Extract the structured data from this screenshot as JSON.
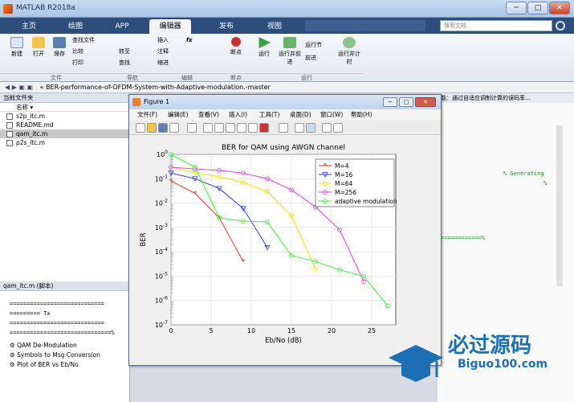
{
  "window": {
    "title": "MATLAB R2018a",
    "minimize": "─",
    "maximize": "□",
    "close": "✕"
  },
  "tabs": [
    "主页",
    "绘图",
    "APP",
    "编辑器",
    "发布",
    "视图"
  ],
  "search": {
    "placeholder": "搜索文档"
  },
  "ribbon": {
    "new": "新建",
    "open": "打开",
    "save": "保存",
    "find_files": "查找文件",
    "compare": "比较",
    "print": "打印",
    "goto": "转至",
    "find": "查找",
    "insert": "插入",
    "comment": "注释",
    "indent": "缩进",
    "fx": "fx",
    "breakpoints": "断点",
    "run": "运行",
    "run_advance": "运行并前进",
    "run_section": "运行节",
    "advance": "前进",
    "run_time": "运行并计时",
    "groups": {
      "file": "文件",
      "navigate": "导航",
      "edit": "编辑",
      "breakpoints": "断点",
      "run": "运行"
    }
  },
  "path": {
    "text": "«  BER-performance-of-OFDM-System-with-Adaptive-modulation.-master"
  },
  "current_folder": {
    "header": "当前文件夹",
    "name_col": "名称 ▾",
    "files": [
      "s2p_itc.m",
      "README.md",
      "qam_itc.m",
      "p2s_itc.m"
    ],
    "selected": 2
  },
  "details": {
    "header": "qam_itc.m  (脚本)",
    "lines": [
      "============================",
      "========= Tx",
      "============================",
      "==============================%"
    ],
    "items": [
      "QAM De-Modulation",
      "Symbols to Msg Conversion",
      "Plot of  BER vs Eb/No"
    ]
  },
  "editor_right": {
    "header": "能：通过自适应调制计算的误码率...",
    "line1": "% Generating",
    "line2": "%",
    "line3": "=============%"
  },
  "figure": {
    "title": "Figure 1",
    "menu": [
      "文件(F)",
      "编辑(E)",
      "查看(V)",
      "插入(I)",
      "工具(T)",
      "桌面(D)",
      "窗口(W)",
      "帮助(H)"
    ]
  },
  "watermark": {
    "cn": "必过源码",
    "en": "Biguo100.com"
  },
  "chart_data": {
    "type": "line",
    "title": "BER for QAM using AWGN channel",
    "xlabel": "Eb/No (dB)",
    "ylabel": "BER",
    "xlim": [
      0,
      28
    ],
    "ylim": [
      1e-07,
      1
    ],
    "yscale": "log",
    "grid": true,
    "legend_position": "top-right",
    "xticks": [
      0,
      5,
      10,
      15,
      20,
      25
    ],
    "yticks": [
      "10^0",
      "10^-1",
      "10^-2",
      "10^-3",
      "10^-4",
      "10^-5",
      "10^-6",
      "10^-7"
    ],
    "series": [
      {
        "name": "M=4",
        "color": "#e8322b",
        "marker": "*",
        "x": [
          0,
          3,
          6,
          9
        ],
        "y": [
          0.08,
          0.025,
          0.0025,
          4e-05
        ]
      },
      {
        "name": "M=16",
        "color": "#2b3fd6",
        "marker": "v",
        "x": [
          0,
          3,
          6,
          9,
          12
        ],
        "y": [
          0.17,
          0.1,
          0.04,
          0.006,
          0.00015
        ]
      },
      {
        "name": "M=64",
        "color": "#f2e600",
        "marker": "o",
        "x": [
          0,
          3,
          6,
          9,
          12,
          15,
          18
        ],
        "y": [
          0.3,
          0.18,
          0.12,
          0.07,
          0.03,
          0.003,
          2e-05
        ]
      },
      {
        "name": "M=256",
        "color": "#e53ef2",
        "marker": "o",
        "x": [
          0,
          3,
          6,
          9,
          12,
          15,
          18,
          21,
          24
        ],
        "y": [
          0.3,
          0.25,
          0.22,
          0.17,
          0.1,
          0.035,
          0.007,
          0.0008,
          6e-06
        ]
      },
      {
        "name": "adaptive modulation",
        "color": "#3ef23e",
        "marker": "o",
        "x": [
          0,
          3,
          6,
          9,
          12,
          15,
          18,
          21,
          24,
          27
        ],
        "y": [
          1,
          0.3,
          0.0025,
          0.0018,
          0.0017,
          7e-05,
          4e-05,
          1.8e-05,
          1e-05,
          6e-07
        ]
      }
    ]
  }
}
